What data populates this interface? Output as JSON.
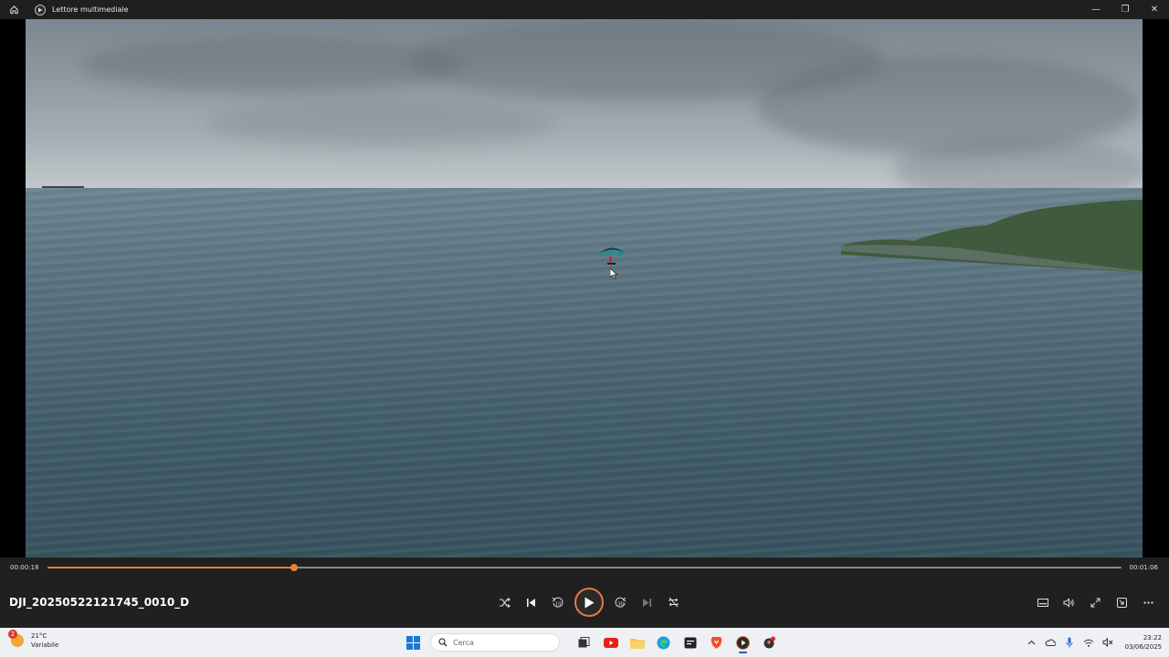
{
  "window": {
    "title": "Lettore multimediale",
    "controls": {
      "minimize": "—",
      "restore": "❐",
      "close": "✕"
    }
  },
  "player": {
    "current_time": "00:00:18",
    "duration": "00:01:06",
    "progress_fraction": 0.23,
    "filename": "DJI_20250522121745_0010_D",
    "accent_color": "#ef7b3b"
  },
  "taskbar": {
    "weather": {
      "badge": "2",
      "temp": "21°C",
      "condition": "Variabile"
    },
    "search_placeholder": "Cerca",
    "clock": {
      "time": "23:22",
      "date": "03/06/2025"
    }
  }
}
